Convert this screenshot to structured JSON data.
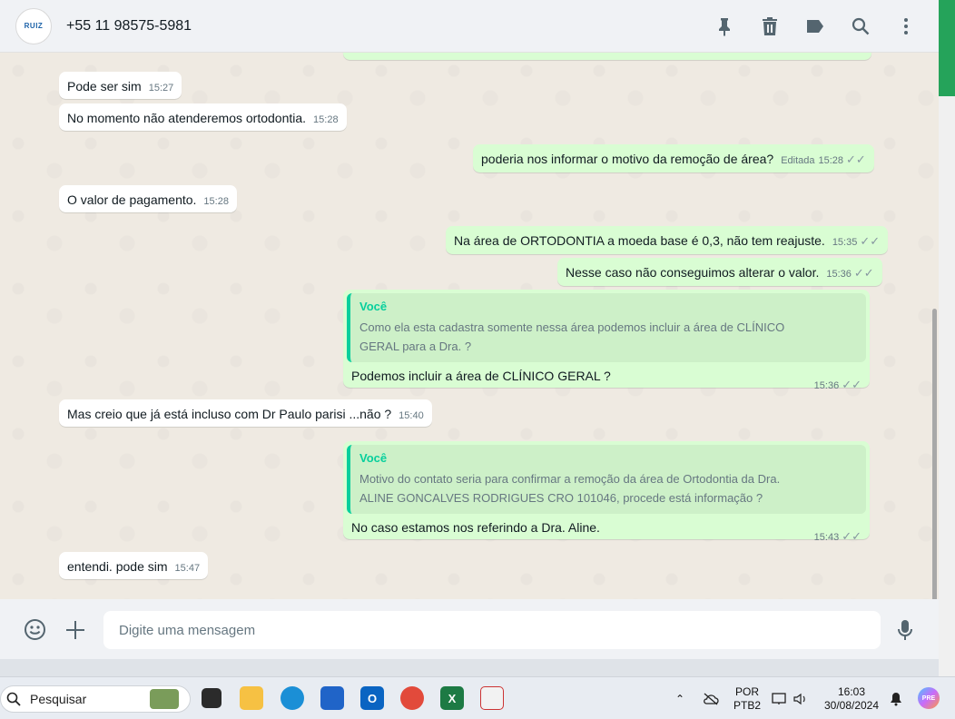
{
  "header": {
    "avatar_text": "RUIZ",
    "contact": "+55 11 98575-5981"
  },
  "messages": [
    {
      "dir": "in",
      "text": "Pode ser sim",
      "time": "15:27"
    },
    {
      "dir": "in",
      "text": "No momento não atenderemos ortodontia.",
      "time": "15:28"
    },
    {
      "dir": "out",
      "text": "poderia nos informar o motivo da remoção de área?",
      "edited": "Editada",
      "time": "15:28"
    },
    {
      "dir": "in",
      "text": "O valor de pagamento.",
      "time": "15:28"
    },
    {
      "dir": "out",
      "text": "Na área de ORTODONTIA a moeda base é 0,3, não tem reajuste.",
      "time": "15:35"
    },
    {
      "dir": "out",
      "text": "Nesse caso não conseguimos alterar o valor.",
      "time": "15:36"
    },
    {
      "dir": "out",
      "quote_author": "Você",
      "quote_line1": "Como ela esta cadastra somente nessa área podemos incluir a área de CLÍNICO",
      "quote_line2": "GERAL para a Dra. ?",
      "text": "Podemos incluir a área de CLÍNICO GERAL ?",
      "time": "15:36"
    },
    {
      "dir": "in",
      "text": "Mas creio que já está incluso com Dr Paulo parisi ...não ?",
      "time": "15:40"
    },
    {
      "dir": "out",
      "quote_author": "Você",
      "quote_line1": "Motivo do contato seria para confirmar a remoção da área de Ortodontia da Dra.",
      "quote_line2": "ALINE GONCALVES RODRIGUES  CRO 101046, procede está informação ?",
      "text": "No caso estamos nos referindo a Dra. Aline.",
      "time": "15:43"
    },
    {
      "dir": "in",
      "text": "entendi. pode sim",
      "time": "15:47"
    }
  ],
  "input": {
    "placeholder": "Digite uma mensagem"
  },
  "taskbar": {
    "search_label": "Pesquisar",
    "lang_line1": "POR",
    "lang_line2": "PTB2",
    "time": "16:03",
    "date": "30/08/2024"
  },
  "colors": {
    "outgoing_bubble": "#d9fdd3",
    "incoming_bubble": "#ffffff",
    "accent": "#06cf9c"
  }
}
